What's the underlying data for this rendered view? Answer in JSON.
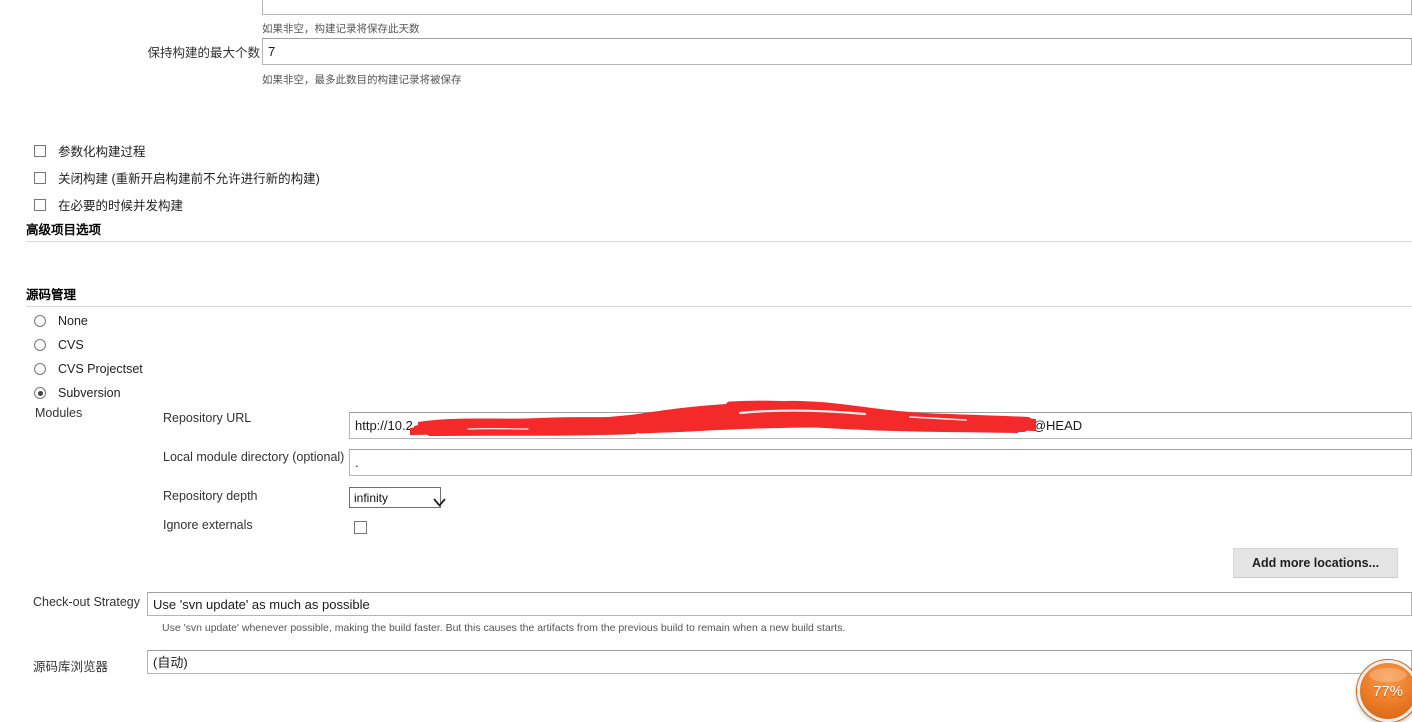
{
  "build_discard": {
    "days_help": "如果非空，构建记录将保存此天数",
    "max_builds_label": "保持构建的最大个数",
    "max_builds_value": "7",
    "max_builds_help": "如果非空，最多此数目的构建记录将被保存"
  },
  "options": {
    "checkboxes": [
      {
        "label": "参数化构建过程",
        "checked": false
      },
      {
        "label": "关闭构建 (重新开启构建前不允许进行新的构建)",
        "checked": false
      },
      {
        "label": "在必要的时候并发构建",
        "checked": false
      }
    ],
    "advanced_heading": "高级项目选项"
  },
  "scm": {
    "heading": "源码管理",
    "radios": [
      {
        "label": "None",
        "checked": false
      },
      {
        "label": "CVS",
        "checked": false
      },
      {
        "label": "CVS Projectset",
        "checked": false
      },
      {
        "label": "Subversion",
        "checked": true
      }
    ],
    "modules_label": "Modules",
    "repository_url_label": "Repository URL",
    "repository_url_value_prefix": "http://10.2",
    "repository_url_value_suffix": "@HEAD",
    "local_module_label": "Local module directory (optional)",
    "local_module_value": ".",
    "repository_depth_label": "Repository depth",
    "repository_depth_value": "infinity",
    "ignore_externals_label": "Ignore externals",
    "ignore_externals_checked": false,
    "add_more_locations_label": "Add more locations...",
    "redaction_color": "#f42a2a"
  },
  "checkout": {
    "label": "Check-out Strategy",
    "value": "Use 'svn update' as much as possible",
    "help": "Use 'svn update' whenever possible, making the build faster. But this causes the artifacts from the previous build to remain when a new build starts."
  },
  "repo_browser": {
    "label": "源码库浏览器",
    "value": "(自动)"
  },
  "zoom_badge": {
    "value": "77%",
    "color": "#ef7f2b"
  }
}
